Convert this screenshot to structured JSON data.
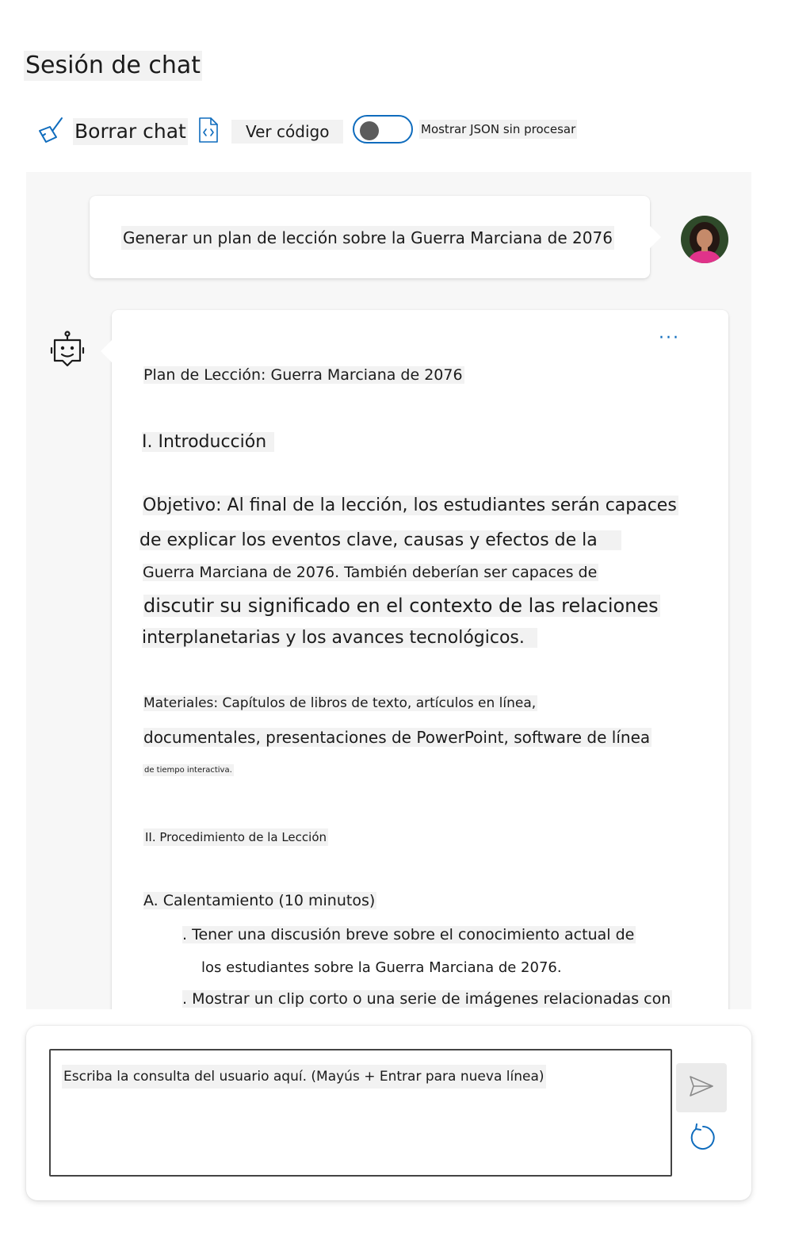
{
  "page": {
    "title": "Sesión de chat"
  },
  "toolbar": {
    "clear_label": "Borrar chat",
    "code_label": "Ver código",
    "json_toggle_label": "Mostrar JSON sin procesar",
    "json_toggle_on": false,
    "accent_color": "#0f6cbd"
  },
  "icons": {
    "clear": "broom-icon",
    "code": "code-file-icon",
    "bot": "bot-icon",
    "send": "send-icon",
    "refresh": "refresh-icon",
    "more": "more-options-icon"
  },
  "chat": {
    "user_message": "Generar un plan de lección sobre la Guerra Marciana de 2076",
    "more_label": "···",
    "bot_lines": [
      "Plan de Lección: Guerra Marciana de 2076",
      "I. Introducción",
      "Objetivo: Al final de la lección, los estudiantes serán capaces",
      "de explicar los eventos clave, causas y efectos de la",
      "Guerra Marciana de 2076. También deberían ser capaces de",
      "discutir su significado en el contexto de las relaciones",
      "interplanetarias y los avances tecnológicos.",
      "Materiales: Capítulos de libros de texto, artículos en línea,",
      "documentales, presentaciones de PowerPoint, software de línea",
      "de tiempo interactiva.",
      "II. Procedimiento de la Lección",
      "A. Calentamiento (10 minutos)",
      ". Tener una discusión breve sobre el conocimiento actual de",
      "los estudiantes sobre la Guerra Marciana de 2076.",
      ". Mostrar un clip corto o una serie de imágenes relacionadas con"
    ]
  },
  "composer": {
    "placeholder": "Escriba la consulta del usuario aquí. (Mayús + Entrar para nueva línea)"
  }
}
